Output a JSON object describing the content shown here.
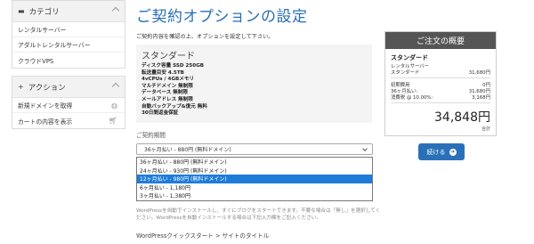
{
  "sidebar": {
    "category": {
      "title": "カテゴリ",
      "items": [
        "レンタルサーバー",
        "アダルトレンタルサーバー",
        "クラウドVPS"
      ]
    },
    "action": {
      "title": "アクション",
      "items": [
        "新規ドメインを取得",
        "カートの内容を表示"
      ]
    }
  },
  "main": {
    "title": "ご契約オプションの設定",
    "intro": "ご契約内容を確認の上、オプションを設定して下さい。",
    "plan_name": "スタンダード",
    "specs": [
      "ディスク容量 SSD 250GB",
      "転送量目安 4.5TB",
      "4vCPUs / 4GBメモリ",
      "マルチドメイン 無制限",
      "データベース 無制限",
      "メールアドレス 無制限",
      "自動バックアップ&復元 無料",
      "30日間返金保証"
    ],
    "term_label": "ご契約期間",
    "term_selected": "36ヶ月払い - 880円 (無料ドメイン)",
    "term_options": [
      "36ヶ月払い - 880円 (無料ドメイン)",
      "24ヶ月払い - 930円 (無料ドメイン)",
      "12ヶ月払い - 980円 (無料ドメイン)",
      "6ヶ月払い - 1,180円",
      "3ヶ月払い - 1,380円"
    ],
    "note": "WordPressを自動でインストールし、すぐにブログをスタートできます。不要な場合は「無し」を選択してください。WordPressを自動インストールする場合は下記入力欄をご記入ください。",
    "wp_line": "WordPressクイックスタート > サイトのタイトル"
  },
  "order": {
    "header": "ご注文の概要",
    "plan": "スタンダード",
    "category": "レンタルサーバー",
    "plan_fee_label": "スタンダード",
    "plan_fee": "31,680円",
    "setup_label": "初期費用",
    "setup_fee": "0円",
    "term_label": "36ヶ月払い:",
    "term_fee": "31,680円",
    "tax_label": "消費税 @ 10.00%:",
    "tax": "3,168円",
    "total": "34,848円",
    "total_label": "合計"
  },
  "next_button": "続ける"
}
